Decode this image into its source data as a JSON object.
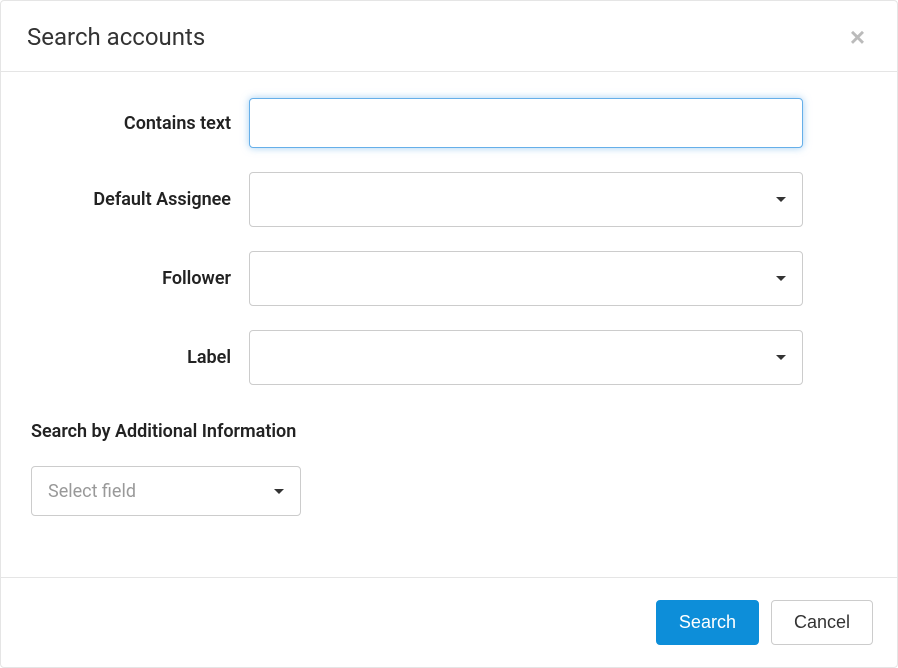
{
  "modal": {
    "title": "Search accounts"
  },
  "form": {
    "contains_text": {
      "label": "Contains text",
      "value": ""
    },
    "default_assignee": {
      "label": "Default Assignee",
      "value": ""
    },
    "follower": {
      "label": "Follower",
      "value": ""
    },
    "label_field": {
      "label": "Label",
      "value": ""
    },
    "additional_info": {
      "heading": "Search by Additional Information",
      "placeholder": "Select field"
    }
  },
  "footer": {
    "search_label": "Search",
    "cancel_label": "Cancel"
  }
}
